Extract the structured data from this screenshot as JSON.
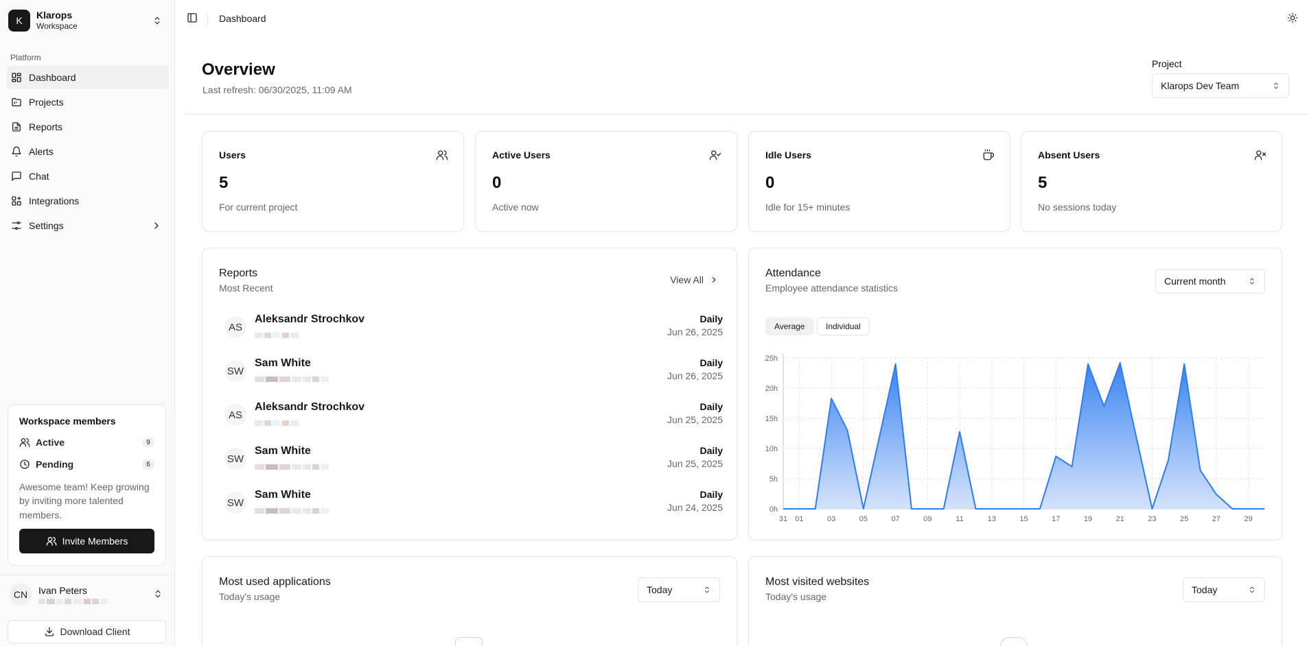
{
  "workspace": {
    "logo_letter": "K",
    "name": "Klarops",
    "sub": "Workspace"
  },
  "sidebar": {
    "group_label": "Platform",
    "items": [
      {
        "label": "Dashboard",
        "icon": "dashboard-icon"
      },
      {
        "label": "Projects",
        "icon": "projects-icon"
      },
      {
        "label": "Reports",
        "icon": "file-icon"
      },
      {
        "label": "Alerts",
        "icon": "bell-icon"
      },
      {
        "label": "Chat",
        "icon": "chat-icon"
      },
      {
        "label": "Integrations",
        "icon": "integrations-icon"
      },
      {
        "label": "Settings",
        "icon": "settings-icon"
      }
    ]
  },
  "members": {
    "title": "Workspace members",
    "active_label": "Active",
    "active_count": "9",
    "pending_label": "Pending",
    "pending_count": "6",
    "description": "Awesome team! Keep growing by inviting more talented members.",
    "invite_label": "Invite Members"
  },
  "user": {
    "initials": "CN",
    "name": "Ivan Peters"
  },
  "download_label": "Download Client",
  "topbar": {
    "breadcrumb": "Dashboard"
  },
  "overview": {
    "title": "Overview",
    "refresh": "Last refresh: 06/30/2025, 11:09 AM",
    "project_label": "Project",
    "project_value": "Klarops Dev Team"
  },
  "stats": [
    {
      "title": "Users",
      "value": "5",
      "sub": "For current project",
      "icon": "users-icon"
    },
    {
      "title": "Active Users",
      "value": "0",
      "sub": "Active now",
      "icon": "user-check-icon"
    },
    {
      "title": "Idle Users",
      "value": "0",
      "sub": "Idle for 15+ minutes",
      "icon": "coffee-icon"
    },
    {
      "title": "Absent Users",
      "value": "5",
      "sub": "No sessions today",
      "icon": "user-x-icon"
    }
  ],
  "reports": {
    "title": "Reports",
    "subtitle": "Most Recent",
    "view_all": "View All",
    "rows": [
      {
        "initials": "AS",
        "name": "Aleksandr Strochkov",
        "type": "Daily",
        "date": "Jun 26, 2025"
      },
      {
        "initials": "SW",
        "name": "Sam White",
        "type": "Daily",
        "date": "Jun 26, 2025"
      },
      {
        "initials": "AS",
        "name": "Aleksandr Strochkov",
        "type": "Daily",
        "date": "Jun 25, 2025"
      },
      {
        "initials": "SW",
        "name": "Sam White",
        "type": "Daily",
        "date": "Jun 25, 2025"
      },
      {
        "initials": "SW",
        "name": "Sam White",
        "type": "Daily",
        "date": "Jun 24, 2025"
      }
    ]
  },
  "attendance": {
    "title": "Attendance",
    "subtitle": "Employee attendance statistics",
    "period": "Current month",
    "tab_average": "Average",
    "tab_individual": "Individual"
  },
  "apps": {
    "title": "Most used applications",
    "subtitle": "Today's usage",
    "period": "Today"
  },
  "websites": {
    "title": "Most visited websites",
    "subtitle": "Today's usage",
    "period": "Today"
  },
  "colors": {
    "accent": "#2f7cf0",
    "dark": "#18181b",
    "muted": "#66666e",
    "border": "#e4e4e7"
  },
  "chart_data": {
    "type": "area",
    "x": [
      "31",
      "01",
      "02",
      "03",
      "04",
      "05",
      "06",
      "07",
      "08",
      "09",
      "10",
      "11",
      "12",
      "13",
      "14",
      "15",
      "16",
      "17",
      "18",
      "19",
      "20",
      "21",
      "22",
      "23",
      "24",
      "25",
      "26",
      "27",
      "28",
      "29",
      "30"
    ],
    "xticks": [
      "31",
      "01",
      "03",
      "05",
      "07",
      "09",
      "11",
      "13",
      "15",
      "17",
      "19",
      "21",
      "23",
      "25",
      "27",
      "29"
    ],
    "series": [
      {
        "values": [
          0,
          0,
          0,
          18.3,
          13,
          0,
          12,
          24,
          0,
          0,
          0,
          12.8,
          0,
          0,
          0,
          0,
          0,
          8.7,
          7,
          24,
          17,
          24.2,
          12,
          0,
          8,
          24,
          6.4,
          2.4,
          0,
          0,
          0
        ]
      }
    ],
    "yticks": [
      "0h",
      "5h",
      "10h",
      "15h",
      "20h",
      "25h"
    ],
    "ylim": [
      0,
      25
    ],
    "grid": true
  }
}
